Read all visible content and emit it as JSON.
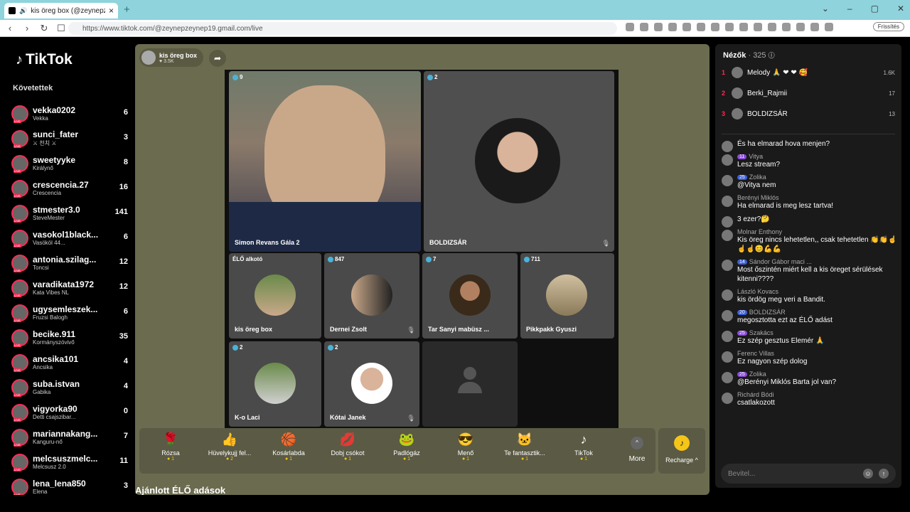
{
  "browser": {
    "tab_title": "kis öreg box (@zeynepzeyne",
    "url": "https://www.tiktok.com/@zeynepzeynep19.gmail.com/live",
    "update_button": "Frissítés"
  },
  "sidebar": {
    "logo": "TikTok",
    "following_header": "Követettek",
    "items": [
      {
        "name": "vekka0202",
        "sub": "Vekka",
        "count": "6"
      },
      {
        "name": "sunci_fater",
        "sub": "⚔ 천치 ⚔",
        "count": "3"
      },
      {
        "name": "sweetyyke",
        "sub": "Királynő",
        "count": "8"
      },
      {
        "name": "crescencia.27",
        "sub": "Crescencia",
        "count": "16"
      },
      {
        "name": "stmester3.0",
        "sub": "SteveMester",
        "count": "141"
      },
      {
        "name": "vasokol1black...",
        "sub": "Vasököl 44...",
        "count": "6"
      },
      {
        "name": "antonia.szilag...",
        "sub": "Toncsi",
        "count": "12"
      },
      {
        "name": "varadikata1972",
        "sub": "Kata Vibes NL",
        "count": "12"
      },
      {
        "name": "ugysemleszek...",
        "sub": "Fruzsi Balogh",
        "count": "6"
      },
      {
        "name": "becike.911",
        "sub": "Kormányszóvivő",
        "count": "35"
      },
      {
        "name": "ancsika101",
        "sub": "Ancsika",
        "count": "4"
      },
      {
        "name": "suba.istvan",
        "sub": "Gabika",
        "count": "4"
      },
      {
        "name": "vigyorka90",
        "sub": "Detti csajszibar...",
        "count": "0"
      },
      {
        "name": "mariannakang...",
        "sub": "Kanguru-nő",
        "count": "7"
      },
      {
        "name": "melcsuszmelc...",
        "sub": "Melcsusz 2.0",
        "count": "11"
      },
      {
        "name": "lena_lena850",
        "sub": "Elena",
        "count": "3"
      }
    ]
  },
  "host": {
    "name": "kis öreg box",
    "likes": "3.5K"
  },
  "stage": {
    "cells": [
      {
        "views": "9",
        "label": "Simon Revans Gála 2"
      },
      {
        "views": "2",
        "label": "BOLDIZSÁR"
      },
      {
        "views": "ÉLŐ alkotó",
        "label": "kis öreg box"
      },
      {
        "views": "847",
        "label": "Dernei Zsolt"
      },
      {
        "views": "7",
        "label": "Tar Sanyi mabüsz ..."
      },
      {
        "views": "711",
        "label": "Pikkpakk Gyuszi"
      },
      {
        "views": "2",
        "label": "K-o Laci"
      },
      {
        "views": "2",
        "label": "Kótai Janek"
      }
    ]
  },
  "gifts": [
    {
      "icon": "🌹",
      "name": "Rózsa",
      "price": "1"
    },
    {
      "icon": "👍",
      "name": "Hüvelykujj fel...",
      "price": "2"
    },
    {
      "icon": "🏀",
      "name": "Kosárlabda",
      "price": "1"
    },
    {
      "icon": "💋",
      "name": "Dobj csókot",
      "price": "1"
    },
    {
      "icon": "🐸",
      "name": "Padlógáz",
      "price": "1"
    },
    {
      "icon": "😎",
      "name": "Menő",
      "price": "1"
    },
    {
      "icon": "🐱",
      "name": "Te fantasztik...",
      "price": "1"
    },
    {
      "icon": "♪",
      "name": "TikTok",
      "price": "1"
    }
  ],
  "more_label": "More",
  "recharge_label": "Recharge",
  "recommended_header": "Ajánlott ÉLŐ adások",
  "viewers": {
    "header": "Nézők",
    "count": "· 325",
    "top": [
      {
        "rank": "1",
        "name": "Melody 🙏 ❤ ❤ 🥰",
        "score": "1.6K"
      },
      {
        "rank": "2",
        "name": "Berki_Rajmii",
        "score": "17"
      },
      {
        "rank": "3",
        "name": "BOLDIZSÁR",
        "score": "13"
      }
    ]
  },
  "chat": [
    {
      "user": "",
      "badge": "",
      "text": "És ha elmarad hova menjen?"
    },
    {
      "user": "Vitya",
      "badge": "11",
      "text": "Lesz stream?"
    },
    {
      "user": "Zolika",
      "badge": "25",
      "text": "@Vitya nem"
    },
    {
      "user": "Berényi Miklós",
      "badge": "",
      "text": "Ha elmarad is meg lesz tartva!"
    },
    {
      "user": "",
      "badge": "",
      "text": "3 ezer?🤔"
    },
    {
      "user": "Molnar Enthony",
      "badge": "",
      "text": "Kis öreg nincs lehetetlen,, csak tehetetlen 👏👏☝☝☝😊💪💪"
    },
    {
      "user": "Sándor Gábor maci ...",
      "badge": "14",
      "text": "Most őszintén miért kell a kis öreget sérülések kitenni????"
    },
    {
      "user": "László Kovacs",
      "badge": "",
      "text": "kis ördög meg veri a Bandit."
    },
    {
      "user": "BOLDIZSÁR",
      "badge": "20",
      "text": "megosztotta ezt az ÉLŐ adást"
    },
    {
      "user": "Szakács",
      "badge": "25",
      "text": "Ez szép gesztus Elemér 🙏"
    },
    {
      "user": "Ferenc Villas",
      "badge": "",
      "text": "Ez nagyon szép dolog"
    },
    {
      "user": "Zolika",
      "badge": "25",
      "text": "@Berényi Miklós Barta jol van?"
    },
    {
      "user": "Richárd Bódi",
      "badge": "",
      "text": "csatlakozott"
    }
  ],
  "input_placeholder": "Bevitel..."
}
